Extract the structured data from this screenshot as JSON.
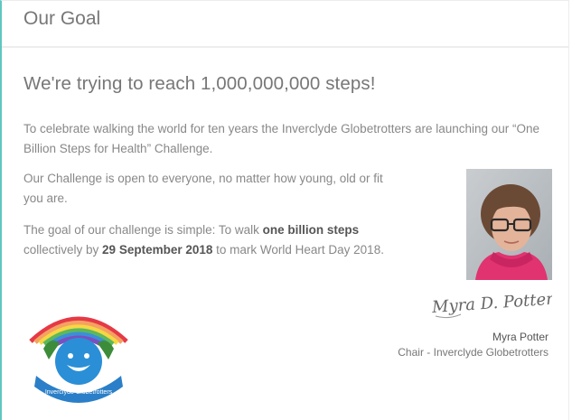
{
  "section": {
    "title": "Our Goal"
  },
  "headline": "We're trying to reach 1,000,000,000 steps!",
  "paragraphs": {
    "p1": "To celebrate walking the world for ten years the Inverclyde Globetrotters are launching our “One Billion Steps for Health” Challenge.",
    "p2": "Our Challenge is open to everyone, no matter how young, old or fit you are.",
    "p3_start": "The goal of our challenge is simple: To walk ",
    "p3_bold1": "one billion steps",
    "p3_mid": " collectively by ",
    "p3_bold2": "29 September 2018",
    "p3_end": " to mark World Heart Day 2018."
  },
  "signature": {
    "handwriting": "Myra D. Potter",
    "name": "Myra Potter",
    "role": "Chair - Inverclyde Globetrotters"
  },
  "logo": {
    "text": "Inverclyde Globetrotters"
  },
  "colors": {
    "accent_border": "#5fc6c0",
    "logo_blue": "#2a8fd6"
  }
}
